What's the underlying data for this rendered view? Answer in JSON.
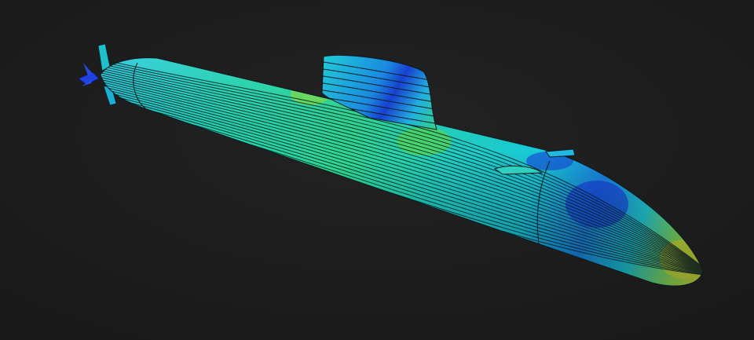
{
  "scene": {
    "background": "#1c1c1c",
    "colormap": [
      "#1a2fd0",
      "#1aa0e6",
      "#18d6c8",
      "#3ad86a",
      "#e8e020"
    ]
  }
}
